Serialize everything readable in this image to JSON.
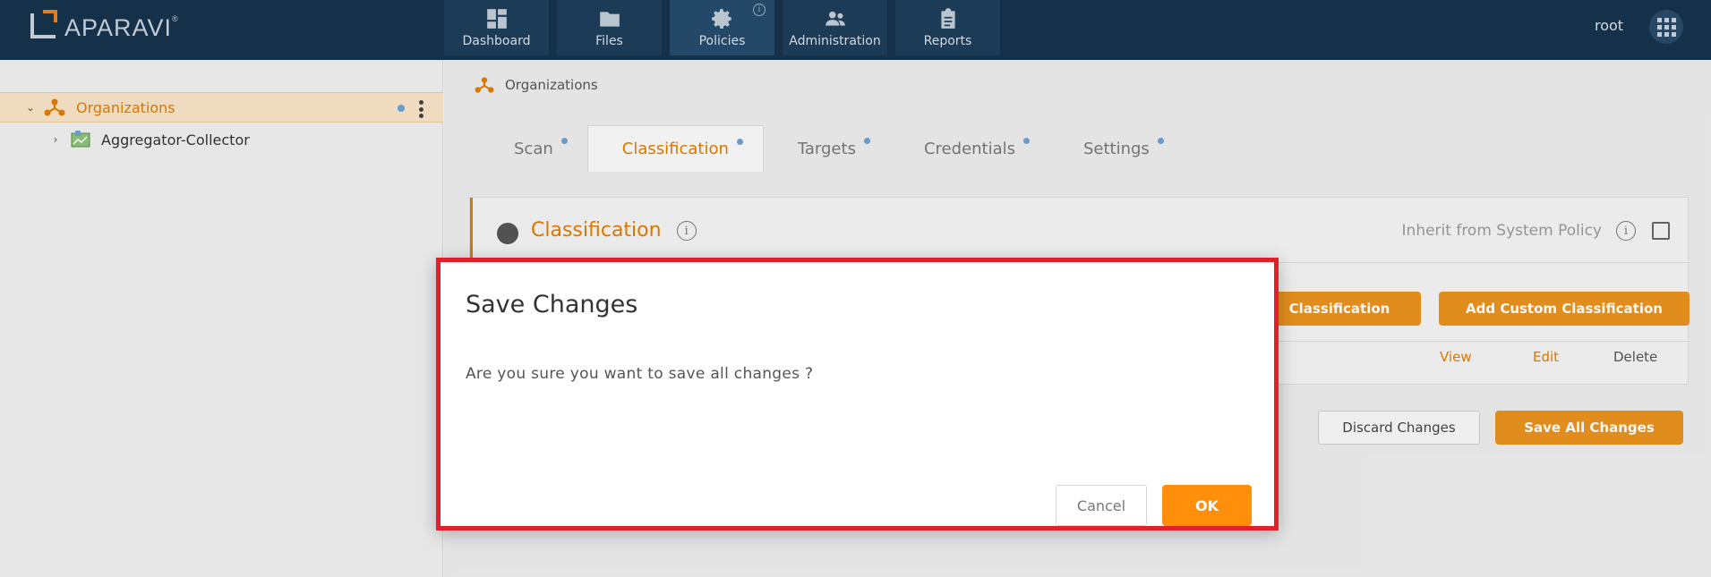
{
  "brand": {
    "name": "APARAVI",
    "reg": "®"
  },
  "nav": {
    "items": [
      {
        "label": "Dashboard",
        "icon": "dashboard-icon"
      },
      {
        "label": "Files",
        "icon": "folder-icon"
      },
      {
        "label": "Policies",
        "icon": "gear-icon",
        "active": true
      },
      {
        "label": "Administration",
        "icon": "users-icon"
      },
      {
        "label": "Reports",
        "icon": "clipboard-icon"
      }
    ],
    "info": "i"
  },
  "user": {
    "name": "root"
  },
  "sidebar": {
    "items": [
      {
        "label": "Organizations",
        "expanded": true,
        "selected": true
      },
      {
        "label": "Aggregator-Collector",
        "expanded": false
      }
    ]
  },
  "breadcrumb": {
    "label": "Organizations"
  },
  "tabs": [
    {
      "label": "Scan"
    },
    {
      "label": "Classification",
      "active": true
    },
    {
      "label": "Targets"
    },
    {
      "label": "Credentials"
    },
    {
      "label": "Settings"
    }
  ],
  "card": {
    "title": "Classification",
    "inherit_label": "Inherit from System Policy",
    "buttons": {
      "add_classification": "Classification",
      "add_custom": "Add Custom Classification"
    },
    "row_actions": {
      "view": "View",
      "edit": "Edit",
      "delete": "Delete"
    }
  },
  "footer_buttons": {
    "discard": "Discard Changes",
    "save_all": "Save All Changes"
  },
  "modal": {
    "title": "Save Changes",
    "message": "Are you sure you want to save all changes ?",
    "cancel": "Cancel",
    "ok": "OK"
  },
  "colors": {
    "accent": "#e07b00",
    "topbar": "#16324c",
    "modal_border": "#e0202b",
    "ok": "#ff8f0a"
  }
}
